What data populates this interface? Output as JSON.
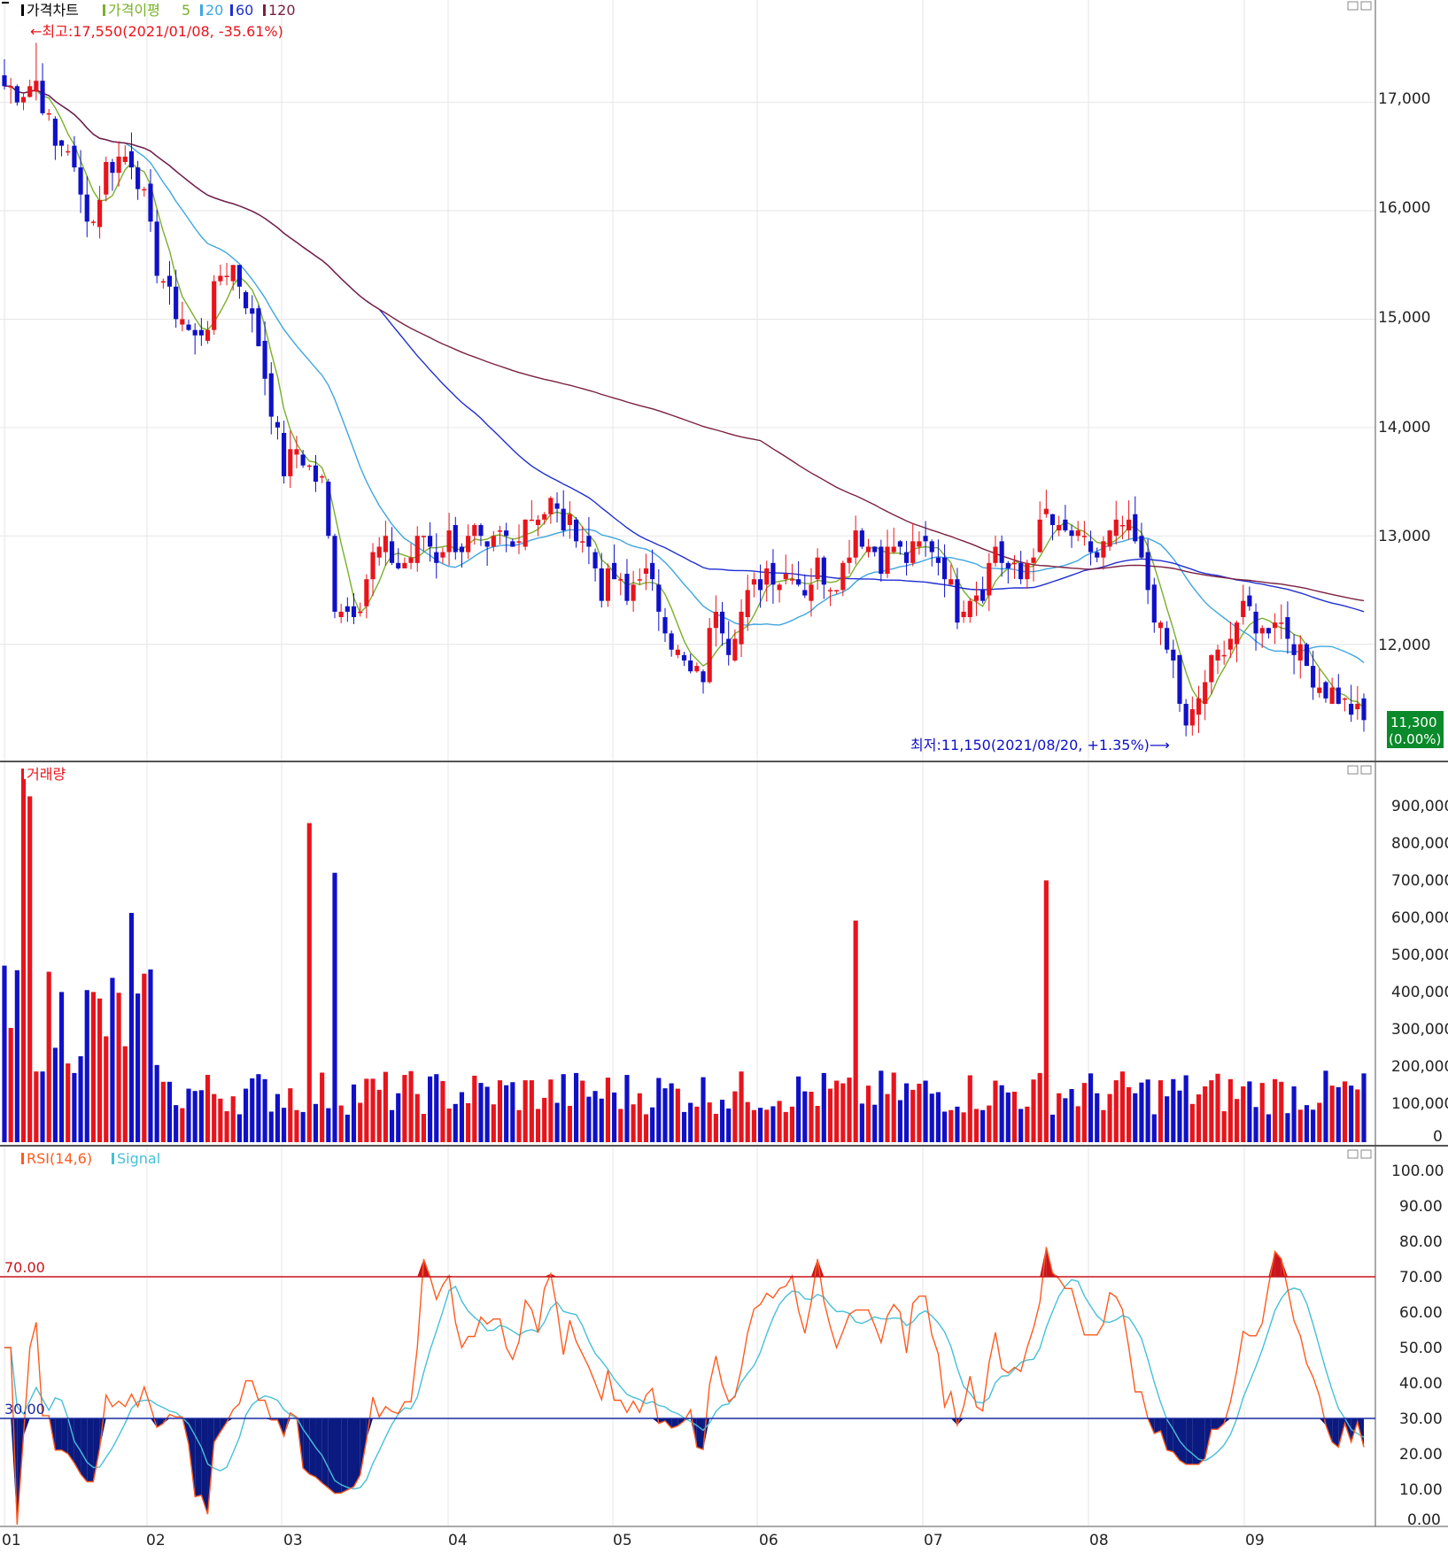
{
  "panels": {
    "price": {
      "legend": {
        "title": "가격차트",
        "ma_label": "가격이평",
        "ma_periods": [
          "5",
          "20",
          "60",
          "120"
        ],
        "ma_colors": [
          "#7ab02a",
          "#3fa6e0",
          "#1f2fd0",
          "#7a2040"
        ]
      },
      "high_annotation": "←최고:17,550(2021/01/08, -35.61%)",
      "low_annotation": "최저:11,150(2021/08/20, +1.35%)⟶",
      "last_price_label": "11,300",
      "last_change_label": "(0.00%)",
      "ytick_labels": [
        "17,000",
        "16,000",
        "15,000",
        "14,000",
        "13,000",
        "12,000"
      ]
    },
    "volume": {
      "title": "거래량",
      "ytick_labels": [
        "900,000",
        "800,000",
        "700,000",
        "600,000",
        "500,000",
        "400,000",
        "300,000",
        "200,000",
        "100,000",
        "0"
      ]
    },
    "rsi": {
      "title": "RSI(14,6)",
      "signal_label": "Signal",
      "level_high_label": "70.00",
      "level_low_label": "30.00",
      "ytick_labels": [
        "100.00",
        "90.00",
        "80.00",
        "70.00",
        "60.00",
        "50.00",
        "40.00",
        "30.00",
        "20.00",
        "10.00",
        "0.00"
      ]
    }
  },
  "x_axis_labels": [
    "01",
    "02",
    "03",
    "04",
    "05",
    "06",
    "07",
    "08",
    "09"
  ],
  "colors": {
    "up": "#e8141c",
    "down": "#1010c8",
    "rsi": "#ff5a1e",
    "signal": "#46c0d8",
    "rsi_high_line": "#c8141c",
    "rsi_low_line": "#1a2aa0",
    "last_price_bg": "#0a8a2a"
  },
  "chart_data": {
    "type": "candlestick",
    "date_range": [
      "2021-01",
      "2021-09"
    ],
    "price_ylim": [
      11000,
      17700
    ],
    "price_ma_periods": [
      5,
      20,
      60,
      120
    ],
    "high": {
      "value": 17550,
      "date": "2021/01/08"
    },
    "low": {
      "value": 11150,
      "date": "2021/08/20"
    },
    "last_close": 11300,
    "close_anchors": [
      [
        0,
        17150
      ],
      [
        3,
        17100
      ],
      [
        5,
        17200
      ],
      [
        8,
        16600
      ],
      [
        10,
        16600
      ],
      [
        12,
        16100
      ],
      [
        14,
        15900
      ],
      [
        16,
        16400
      ],
      [
        18,
        16500
      ],
      [
        20,
        16500
      ],
      [
        22,
        16100
      ],
      [
        24,
        15500
      ],
      [
        26,
        15200
      ],
      [
        28,
        15000
      ],
      [
        30,
        14800
      ],
      [
        32,
        15000
      ],
      [
        34,
        15400
      ],
      [
        36,
        15500
      ],
      [
        38,
        15200
      ],
      [
        40,
        14800
      ],
      [
        42,
        14200
      ],
      [
        44,
        13600
      ],
      [
        46,
        13800
      ],
      [
        48,
        13600
      ],
      [
        50,
        13500
      ],
      [
        52,
        12400
      ],
      [
        54,
        12300
      ],
      [
        56,
        12400
      ],
      [
        58,
        12800
      ],
      [
        60,
        12900
      ],
      [
        62,
        12700
      ],
      [
        64,
        12800
      ],
      [
        66,
        13000
      ],
      [
        68,
        12800
      ],
      [
        70,
        13000
      ],
      [
        72,
        12900
      ],
      [
        74,
        13000
      ],
      [
        76,
        12800
      ],
      [
        78,
        13000
      ],
      [
        80,
        12900
      ],
      [
        82,
        13200
      ],
      [
        84,
        13200
      ],
      [
        86,
        13300
      ],
      [
        88,
        13100
      ],
      [
        90,
        13100
      ],
      [
        92,
        12900
      ],
      [
        94,
        12500
      ],
      [
        96,
        12600
      ],
      [
        98,
        12400
      ],
      [
        100,
        12700
      ],
      [
        102,
        12500
      ],
      [
        104,
        12200
      ],
      [
        106,
        11900
      ],
      [
        108,
        11700
      ],
      [
        110,
        11700
      ],
      [
        112,
        12400
      ],
      [
        114,
        12000
      ],
      [
        116,
        12300
      ],
      [
        118,
        12500
      ],
      [
        120,
        12700
      ],
      [
        122,
        12600
      ],
      [
        124,
        12700
      ],
      [
        126,
        12500
      ],
      [
        128,
        12700
      ],
      [
        130,
        12600
      ],
      [
        132,
        12700
      ],
      [
        134,
        13100
      ],
      [
        136,
        12900
      ],
      [
        138,
        12800
      ],
      [
        140,
        12900
      ],
      [
        142,
        12800
      ],
      [
        144,
        12900
      ],
      [
        146,
        12900
      ],
      [
        148,
        12700
      ],
      [
        150,
        12300
      ],
      [
        152,
        12500
      ],
      [
        154,
        12500
      ],
      [
        156,
        12900
      ],
      [
        158,
        12700
      ],
      [
        160,
        12600
      ],
      [
        162,
        12900
      ],
      [
        164,
        13200
      ],
      [
        166,
        13000
      ],
      [
        168,
        13000
      ],
      [
        170,
        12900
      ],
      [
        172,
        12800
      ],
      [
        174,
        13000
      ],
      [
        176,
        13100
      ],
      [
        178,
        12900
      ],
      [
        180,
        12500
      ],
      [
        182,
        12100
      ],
      [
        184,
        11800
      ],
      [
        186,
        11200
      ],
      [
        188,
        11500
      ],
      [
        190,
        11800
      ],
      [
        192,
        12000
      ],
      [
        194,
        12200
      ],
      [
        196,
        12300
      ],
      [
        198,
        12100
      ],
      [
        200,
        12300
      ],
      [
        202,
        12100
      ],
      [
        204,
        11900
      ],
      [
        206,
        11700
      ],
      [
        208,
        11600
      ],
      [
        210,
        11500
      ],
      [
        212,
        11400
      ],
      [
        214,
        11300
      ]
    ],
    "volume_ylim": [
      0,
      950000
    ],
    "volume_peaks": [
      {
        "index": 3,
        "value": 950000
      },
      {
        "index": 4,
        "value": 905000
      },
      {
        "index": 20,
        "value": 600000
      },
      {
        "index": 48,
        "value": 835000
      },
      {
        "index": 52,
        "value": 705000
      },
      {
        "index": 134,
        "value": 580000
      },
      {
        "index": 164,
        "value": 685000
      }
    ],
    "rsi_ylim": [
      0,
      100
    ],
    "rsi_levels": [
      70,
      30
    ],
    "rsi_period": 14,
    "signal_period": 6
  }
}
